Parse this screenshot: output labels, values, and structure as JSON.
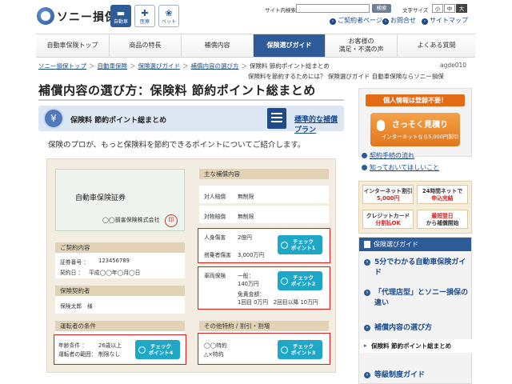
{
  "header": {
    "logo_text": "ソニー損保",
    "icons": [
      {
        "label": "自動車",
        "icon": "car-icon",
        "glyph": "🚗"
      },
      {
        "label": "医療",
        "icon": "medical-icon",
        "glyph": "✚"
      },
      {
        "label": "ペット",
        "icon": "paw-icon",
        "glyph": "🐾"
      }
    ],
    "search_label": "サイト内検索",
    "search_value": "",
    "search_button": "検索",
    "fontsize_label": "文字サイズ",
    "fontsizes": [
      "小",
      "中",
      "大"
    ],
    "links": [
      "ご契約者ページ",
      "お問合せ",
      "サイトマップ"
    ]
  },
  "nav": {
    "items": [
      "自動車保険トップ",
      "商品の特長",
      "補償内容",
      "保険選びガイド",
      "お客様の\n満足・不満の声",
      "よくある質問"
    ]
  },
  "breadcrumb": {
    "items": [
      "ソニー損保トップ",
      "自動車保険",
      "保険選びガイド",
      "補償内容の選び方"
    ],
    "current": "保険料 節約ポイント総まとめ",
    "code": "agde010"
  },
  "sub_tagline": "保険料を節約するためには？ 保険選びガイド 自動車保険ならソニー損保",
  "page_title": "補償内容の選び方：保険料 節約ポイント総まとめ",
  "banner": {
    "coin_glyph": "¥",
    "label": "保険料 節約ポイント総まとめ",
    "link": "標準的な補償プラン"
  },
  "intro": "保険のプロが、もっと保険料を節約できるポイントについてご紹介します。",
  "certificate": {
    "title": "自動車保険証券",
    "company": "◯◯損害保険株式会社",
    "seal": "印"
  },
  "contract": {
    "heading": "ご契約内容",
    "number_label": "証券番号 ：",
    "number_value": "123456789",
    "date_label": "契約日 ：",
    "date_value": "平成◯◯年◯月◯日"
  },
  "insured": {
    "heading": "保険契約者",
    "name": "保険太郎　様"
  },
  "driver": {
    "heading": "運転者の条件",
    "age_label": "年齢条件 ：",
    "age_value": "26歳以上",
    "scope_label": "運転者の範囲：",
    "scope_value": "制限なし"
  },
  "coverage": {
    "heading": "主な補償内容",
    "rows": [
      {
        "key": "対人賠償",
        "value": "無制限"
      },
      {
        "key": "対物賠償",
        "value": "無制限"
      },
      {
        "key": "人身傷害",
        "value": "2億円"
      },
      {
        "key": "搭乗者傷害",
        "value": "3,000万円"
      }
    ],
    "vehicle_key": "車両保険",
    "vehicle_lines": [
      "一般：",
      "140万円",
      "免責金額：",
      "1回目 0万円　2回目以降 10万円"
    ]
  },
  "options": {
    "heading": "その他特約 / 割引・割増",
    "lines": [
      "◯◯特約",
      "△×特約"
    ]
  },
  "check_buttons": [
    {
      "line1": "チェック",
      "line2": "ポイント1"
    },
    {
      "line1": "チェック",
      "line2": "ポイント2"
    },
    {
      "line1": "チェック",
      "line2": "ポイント3"
    },
    {
      "line1": "チェック",
      "line2": "ポイント4"
    }
  ],
  "promo": {
    "tag": "個人情報は登録不要！",
    "button_big": "さっそく見積り",
    "button_small": "インターネットなら5,000円割引"
  },
  "side_links": [
    "契約手続の流れ",
    "知っておいてほしいこと"
  ],
  "badges": [
    {
      "l1": "インターネット割引",
      "l2": "5,000円"
    },
    {
      "l1": "24時間ネットで",
      "l2": "申込完結"
    },
    {
      "l1": "クレジットカード",
      "l2": "分割払OK"
    },
    {
      "l1": "最短翌日",
      "l2": "から補償開始"
    }
  ],
  "guide": {
    "heading": "保険選びガイド",
    "items": [
      "5分でわかる自動車保険ガイド",
      "「代理店型」とソニー損保の違い",
      "補償内容の選び方",
      "等級制度ガイド"
    ],
    "sub_item": "保険料 節約ポイント総まとめ"
  },
  "colors": {
    "brand_blue": "#2c5b98",
    "accent_orange": "#e36b16",
    "check_cyan": "#1ea7c6",
    "highlight_red": "#e02020"
  }
}
